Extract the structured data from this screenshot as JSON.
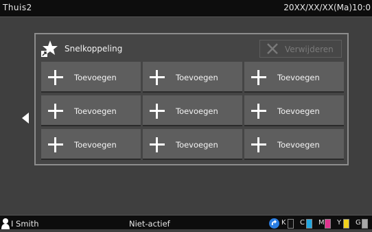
{
  "header": {
    "title": "Thuis2",
    "datetime": "20XX/XX/XX(Ma)10:0"
  },
  "panel": {
    "title": "Snelkoppeling",
    "delete_label": "Verwijderen",
    "tiles": [
      "Toevoegen",
      "Toevoegen",
      "Toevoegen",
      "Toevoegen",
      "Toevoegen",
      "Toevoegen",
      "Toevoegen",
      "Toevoegen",
      "Toevoegen"
    ]
  },
  "footer": {
    "user": "I Smith",
    "status": "Niet-actief",
    "toners": [
      {
        "label": "K",
        "color": "#111111"
      },
      {
        "label": "C",
        "color": "#21a7e0"
      },
      {
        "label": "M",
        "color": "#e0338f"
      },
      {
        "label": "Y",
        "color": "#f1d21c"
      },
      {
        "label": "G",
        "color": "#a7a7a7"
      }
    ]
  },
  "icons": {
    "star": "star-icon",
    "delete": "close-icon",
    "back": "chevron-left-icon",
    "user": "user-icon",
    "toner_help": "refresh-icon"
  }
}
